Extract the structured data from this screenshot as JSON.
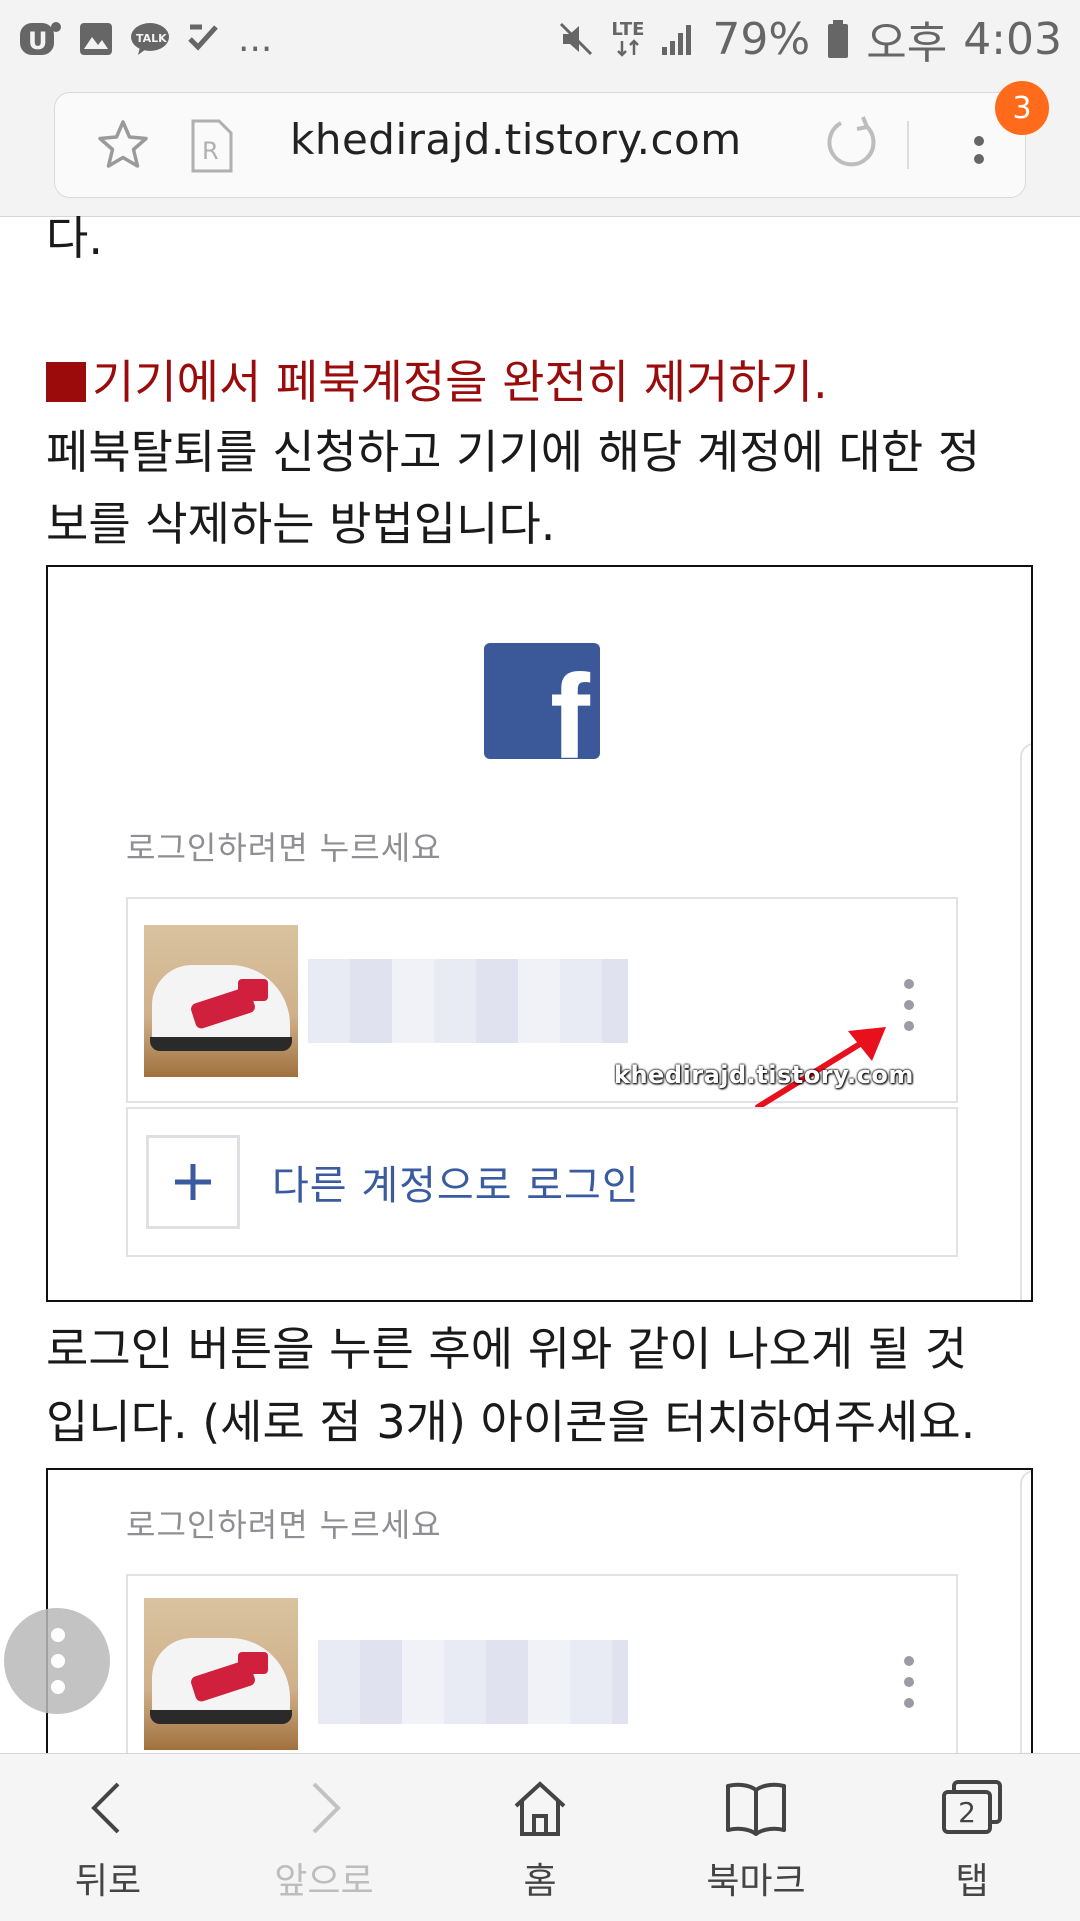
{
  "status_bar": {
    "battery": "79%",
    "time_prefix": "오후",
    "time": "4:03",
    "network": "LTE",
    "overflow": "..."
  },
  "browser": {
    "url": "khedirajd.tistory.com",
    "tab_badge": "3"
  },
  "article": {
    "fragment": "다.",
    "section_heading": "기기에서 페북계정을 완전히 제거하기.",
    "intro_line1": "페북탈퇴를 신청하고 기기에 해당 계정에 대한 정",
    "intro_line2": "보를 삭제하는 방법입니다.",
    "after_line1": "로그인 버튼을 누른 후에 위와 같이 나오게 될 것",
    "after_line2": "입니다. (세로 점 3개) 아이콘을 터치하여주세요."
  },
  "screenshot1": {
    "prompt": "로그인하려면 누르세요",
    "watermark": "khedirajd.tistory.com",
    "add_account": "다른 계정으로 로그인"
  },
  "screenshot2": {
    "prompt": "로그인하려면 누르세요"
  },
  "bottom_nav": {
    "back": "뒤로",
    "forward": "앞으로",
    "home": "홈",
    "bookmarks": "북마크",
    "tabs": "탭",
    "tab_count": "2"
  },
  "colors": {
    "heading_red": "#9b0b0b",
    "facebook_blue": "#3b5998",
    "badge_orange": "#ff6b1a",
    "link_blue": "#3b5ba0",
    "arrow_red": "#e8101c"
  }
}
